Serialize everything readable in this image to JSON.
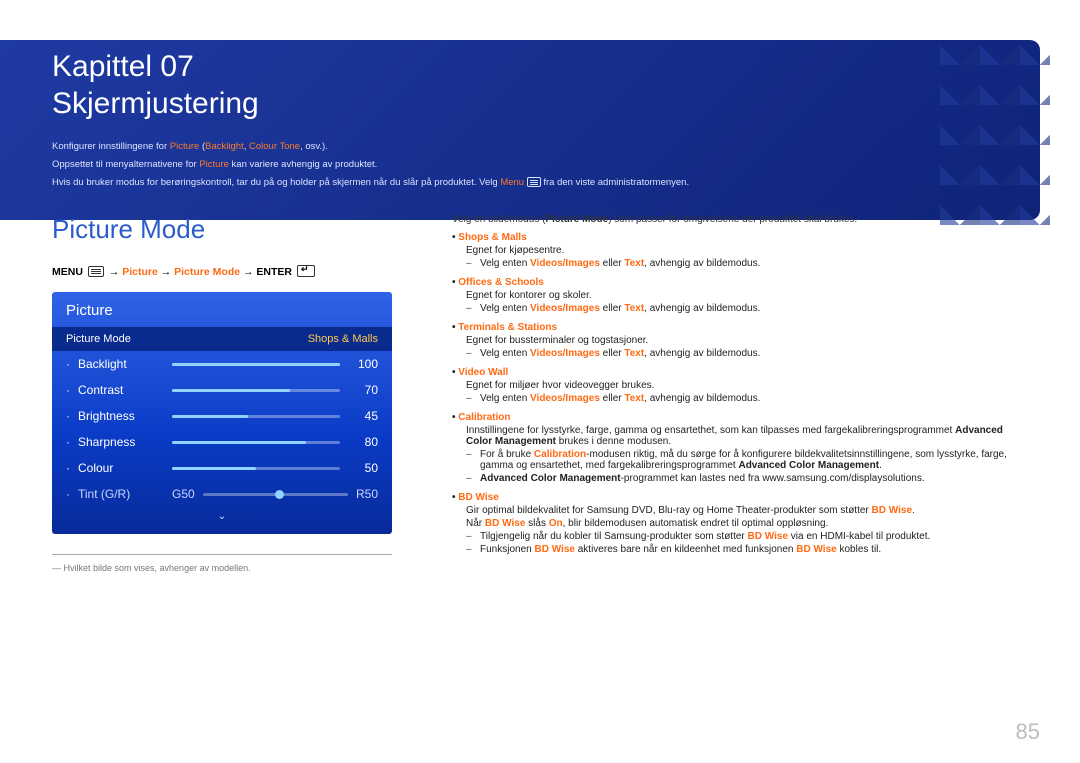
{
  "header": {
    "chapter": "Kapittel  07",
    "title": "Skjermjustering",
    "intro1_pre": "Konfigurer innstillingene for ",
    "intro1_k1": "Picture",
    "intro1_paren_open": " (",
    "intro1_k2": "Backlight",
    "intro1_comma": ", ",
    "intro1_k3": "Colour Tone",
    "intro1_post": ", osv.).",
    "intro2_pre": "Oppsettet til menyalternativene for ",
    "intro2_k": "Picture",
    "intro2_post": " kan variere avhengig av produktet.",
    "intro3_pre": "Hvis du bruker modus for berøringskontroll, tar du på og holder på skjermen når du slår på produktet. Velg ",
    "intro3_k": "Menu",
    "intro3_post": " fra den viste administratormenyen."
  },
  "section_title": "Picture Mode",
  "path": {
    "menu": "MENU",
    "p1": "Picture",
    "p2": "Picture Mode",
    "enter": "ENTER"
  },
  "osd": {
    "title": "Picture",
    "sel_label": "Picture Mode",
    "sel_value": "Shops & Malls",
    "items": [
      {
        "label": "Backlight",
        "value": "100",
        "pct": 100
      },
      {
        "label": "Contrast",
        "value": "70",
        "pct": 70
      },
      {
        "label": "Brightness",
        "value": "45",
        "pct": 45
      },
      {
        "label": "Sharpness",
        "value": "80",
        "pct": 80
      },
      {
        "label": "Colour",
        "value": "50",
        "pct": 50
      }
    ],
    "tint": {
      "label": "Tint (G/R)",
      "g": "G50",
      "r": "R50",
      "pos": 50
    }
  },
  "footnote_dash": "―  ",
  "footnote": "Hvilket bilde som vises, avhenger av modellen.",
  "right": {
    "lead_pre": "Velg en bildemodus (",
    "lead_b": "Picture Mode",
    "lead_post": ") som passer for omgivelsene der produktet skal brukes.",
    "modes": [
      {
        "title": "Shops & Malls",
        "desc": "Egnet for kjøpesentre.",
        "sub": [
          {
            "pre": "Velg enten ",
            "k1": "Videos/Images",
            "mid": " eller ",
            "k2": "Text",
            "post": ", avhengig av bildemodus."
          }
        ]
      },
      {
        "title": "Offices & Schools",
        "desc": "Egnet for kontorer og skoler.",
        "sub": [
          {
            "pre": "Velg enten ",
            "k1": "Videos/Images",
            "mid": " eller ",
            "k2": "Text",
            "post": ", avhengig av bildemodus."
          }
        ]
      },
      {
        "title": "Terminals & Stations",
        "desc": "Egnet for bussterminaler og togstasjoner.",
        "sub": [
          {
            "pre": "Velg enten ",
            "k1": "Videos/Images",
            "mid": " eller ",
            "k2": "Text",
            "post": ", avhengig av bildemodus."
          }
        ]
      },
      {
        "title": "Video Wall",
        "desc": "Egnet for miljøer hvor videovegger brukes.",
        "sub": [
          {
            "pre": "Velg enten ",
            "k1": "Videos/Images",
            "mid": " eller ",
            "k2": "Text",
            "post": ", avhengig av bildemodus."
          }
        ]
      }
    ],
    "calibration": {
      "title": "Calibration",
      "desc_pre": "Innstillingene for lysstyrke, farge, gamma og ensartethet, som kan tilpasses med fargekalibreringsprogrammet ",
      "desc_b": "Advanced Color Management",
      "desc_post": " brukes i denne modusen.",
      "sub1_pre": "For å bruke ",
      "sub1_k": "Calibration",
      "sub1_mid": "-modusen riktig, må du sørge for å konfigurere bildekvalitetsinnstillingene, som lysstyrke, farge, gamma og ensartethet, med fargekalibreringsprogrammet ",
      "sub1_b": "Advanced Color Management",
      "sub1_post": ".",
      "sub2_b": "Advanced Color Management",
      "sub2_post": "-programmet kan lastes ned fra www.samsung.com/displaysolutions."
    },
    "bdwise": {
      "title": "BD Wise",
      "desc_pre": "Gir optimal bildekvalitet for Samsung DVD, Blu-ray og Home Theater-produkter som støtter ",
      "desc_k": "BD Wise",
      "desc_post": ".",
      "line2_pre": "Når ",
      "line2_k": "BD Wise",
      "line2_mid": " slås ",
      "line2_k2": "On",
      "line2_post": ", blir bildemodusen automatisk endret til optimal oppløsning.",
      "sub1_pre": "Tilgjengelig når du kobler til Samsung-produkter som støtter ",
      "sub1_k": "BD Wise",
      "sub1_post": " via en HDMI-kabel til produktet.",
      "sub2_pre": "Funksjonen ",
      "sub2_k": "BD Wise",
      "sub2_mid": " aktiveres bare når en kildeenhet med funksjonen ",
      "sub2_k2": "BD Wise",
      "sub2_post": " kobles til."
    }
  },
  "page_number": "85"
}
